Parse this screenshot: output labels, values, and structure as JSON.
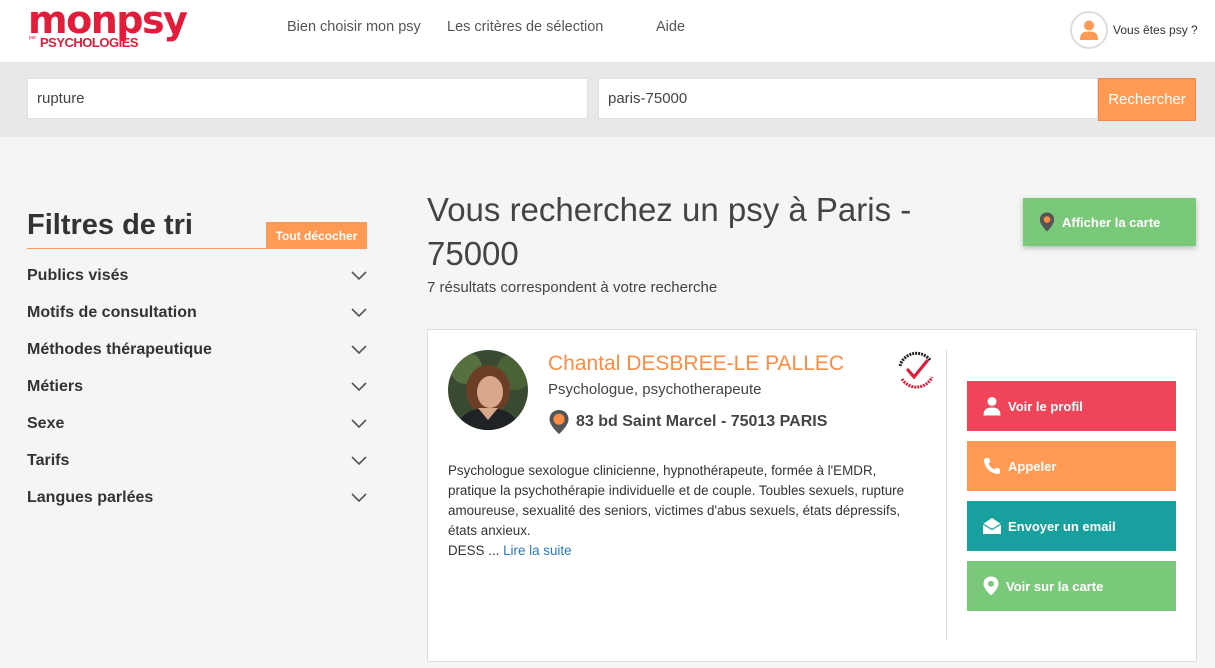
{
  "header": {
    "logo_main": "monpsy",
    "logo_sub": "PSYCHOLOGIES",
    "logo_tiny": "par",
    "nav": [
      "Bien choisir mon psy",
      "Les critères de sélection",
      "Aide"
    ],
    "account_label": "Vous êtes psy ?"
  },
  "search": {
    "query": "rupture",
    "location": "paris-75000",
    "button": "Rechercher"
  },
  "filters": {
    "title": "Filtres de tri",
    "uncheck_all": "Tout décocher",
    "items": [
      "Publics visés",
      "Motifs de consultation",
      "Méthodes thérapeutique",
      "Métiers",
      "Sexe",
      "Tarifs",
      "Langues parlées"
    ]
  },
  "results": {
    "title": "Vous recherchez un psy à Paris - 75000",
    "count_text": "7 résultats correspondent à votre recherche",
    "map_button": "Afficher la carte"
  },
  "card": {
    "name": "Chantal DESBREE-LE PALLEC",
    "profession": "Psychologue, psychotherapeute",
    "address": "83 bd Saint Marcel - 75013 PARIS",
    "badge_top": "RECOMMANDÉ",
    "badge_bottom": "PSYCHOLOGIES",
    "description": "Psychologue sexologue clinicienne, hypnothérapeute, formée à l'EMDR, pratique la psychothérapie individuelle et de couple. Toubles sexuels, rupture amoureuse, sexualité des seniors, victimes d'abus sexuels, états dépressifs, états anxieux.",
    "desc_tail": "DESS ...",
    "read_more": "Lire la suite",
    "actions": {
      "profile": "Voir le profil",
      "call": "Appeler",
      "email": "Envoyer un email",
      "map": "Voir sur la carte"
    }
  },
  "colors": {
    "brand": "#e11d3a",
    "accent_orange": "#ff9a55",
    "name_orange": "#ff8c42",
    "profile_red": "#f0445a",
    "email_teal": "#17a09d",
    "map_green": "#7ac97a",
    "link_blue": "#2a7ab8"
  },
  "icons": [
    "user-icon",
    "chevron-down-icon",
    "map-pin-icon",
    "phone-icon",
    "envelope-icon",
    "recommended-badge-icon"
  ]
}
